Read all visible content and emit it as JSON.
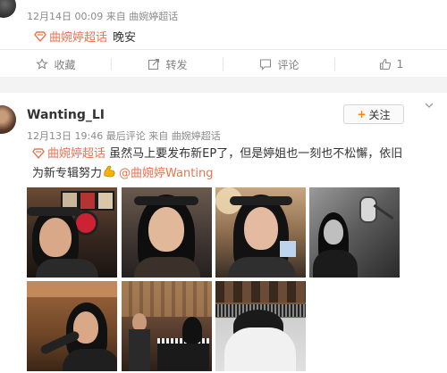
{
  "post1": {
    "timestamp": "12月14日 00:09",
    "source_prefix": "来自",
    "source": "曲婉婷超话",
    "supertopic": "曲婉婷超话",
    "text": "晚安",
    "actions": [
      {
        "label": "收藏",
        "icon": "star-icon"
      },
      {
        "label": "转发",
        "icon": "share-icon"
      },
      {
        "label": "评论",
        "icon": "comment-icon"
      },
      {
        "label": "1",
        "icon": "thumbs-up-icon"
      }
    ]
  },
  "post2": {
    "username": "Wanting_LI",
    "timestamp": "12月13日 19:46",
    "last_comment": "最后评论",
    "source_prefix": "来自",
    "source": "曲婉婷超话",
    "follow_label": "关注",
    "supertopic": "曲婉婷超话",
    "text": "虽然马上要发布新EP了，但是婷姐也一刻也不松懈，依旧为新专辑努力",
    "emoji": "muscle-emoji",
    "mention": "@曲婉婷Wanting"
  },
  "colors": {
    "link": "#eb7350",
    "follow_plus": "#ff8200",
    "muted": "#8a8a8a"
  }
}
